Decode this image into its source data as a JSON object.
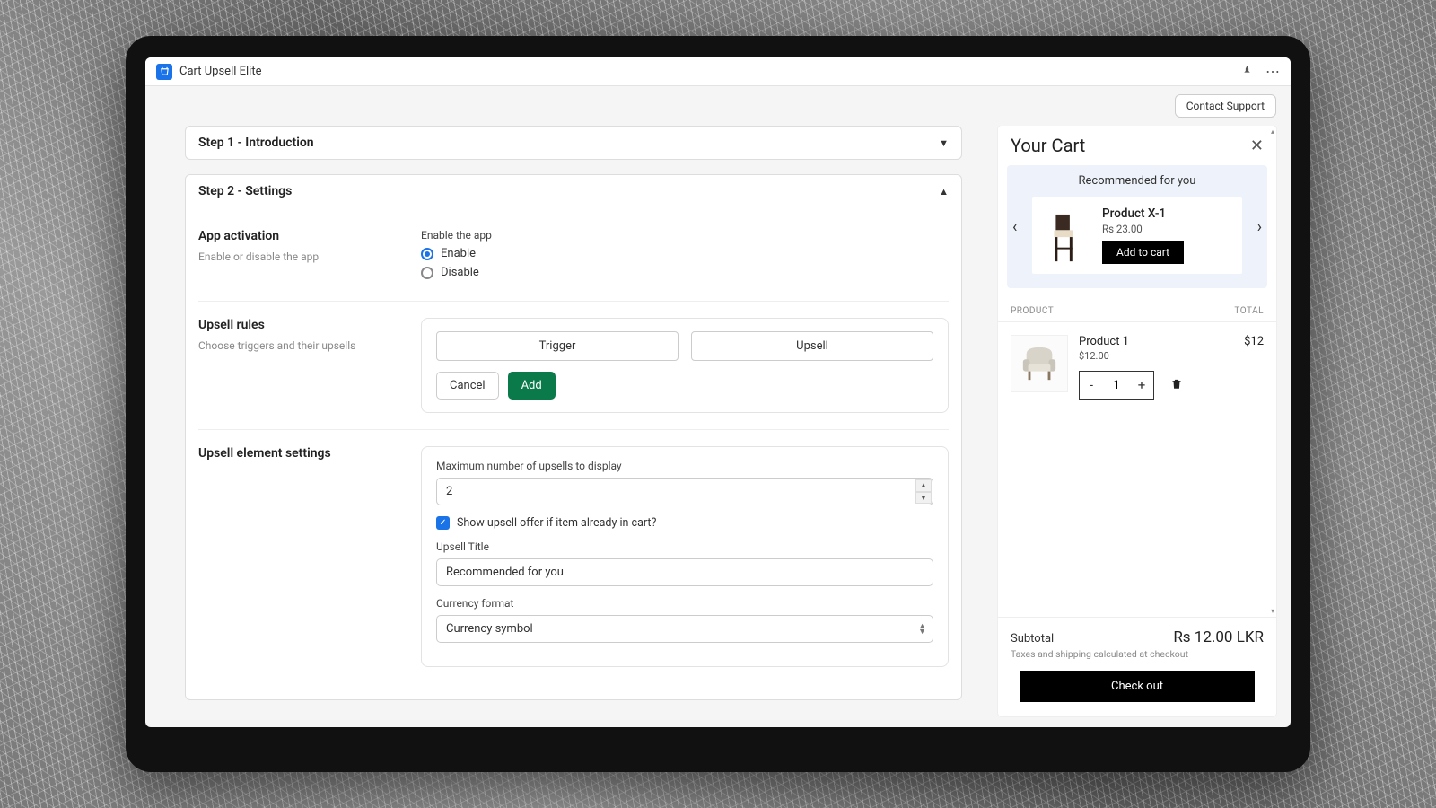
{
  "app": {
    "title": "Cart Upsell Elite"
  },
  "header": {
    "contact_support": "Contact Support"
  },
  "steps": {
    "step1_label": "Step 1 - Introduction",
    "step2_label": "Step 2 - Settings"
  },
  "activation": {
    "title": "App activation",
    "subtitle": "Enable or disable the app",
    "enable_label": "Enable the app",
    "opt_enable": "Enable",
    "opt_disable": "Disable",
    "selected": "enable"
  },
  "rules": {
    "title": "Upsell rules",
    "subtitle": "Choose triggers and their upsells",
    "trigger_label": "Trigger",
    "upsell_label": "Upsell",
    "cancel": "Cancel",
    "add": "Add"
  },
  "element_settings": {
    "title": "Upsell element settings",
    "max_label": "Maximum number of upsells to display",
    "max_value": "2",
    "show_if_in_cart_label": "Show upsell offer if item already in cart?",
    "show_if_in_cart": true,
    "upsell_title_label": "Upsell Title",
    "upsell_title_value": "Recommended for you",
    "currency_label": "Currency format",
    "currency_value": "Currency symbol"
  },
  "cart": {
    "title": "Your Cart",
    "recommended_heading": "Recommended for you",
    "rec_product": {
      "name": "Product X-1",
      "price": "Rs 23.00",
      "add_label": "Add to cart"
    },
    "col_product": "PRODUCT",
    "col_total": "TOTAL",
    "item": {
      "name": "Product 1",
      "price": "$12.00",
      "qty": "1",
      "total": "$12"
    },
    "subtotal_label": "Subtotal",
    "subtotal_value": "Rs 12.00 LKR",
    "tax_note": "Taxes and shipping calculated at checkout",
    "checkout_label": "Check out"
  }
}
